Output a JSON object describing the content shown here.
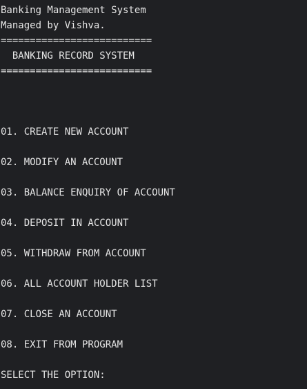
{
  "header": {
    "title": "Banking Management System",
    "subtitle": "Managed by Vishva.",
    "rule_top": "==========================",
    "banner": "  BANKING RECORD SYSTEM",
    "rule_bottom": "=========================="
  },
  "menu": {
    "items": [
      {
        "label": "01. CREATE NEW ACCOUNT"
      },
      {
        "label": "02. MODIFY AN ACCOUNT"
      },
      {
        "label": "03. BALANCE ENQUIRY OF ACCOUNT"
      },
      {
        "label": "04. DEPOSIT IN ACCOUNT"
      },
      {
        "label": "05. WITHDRAW FROM ACCOUNT"
      },
      {
        "label": "06. ALL ACCOUNT HOLDER LIST"
      },
      {
        "label": "07. CLOSE AN ACCOUNT"
      },
      {
        "label": "08. EXIT FROM PROGRAM"
      }
    ]
  },
  "prompt": {
    "text": "SELECT THE OPTION:"
  }
}
